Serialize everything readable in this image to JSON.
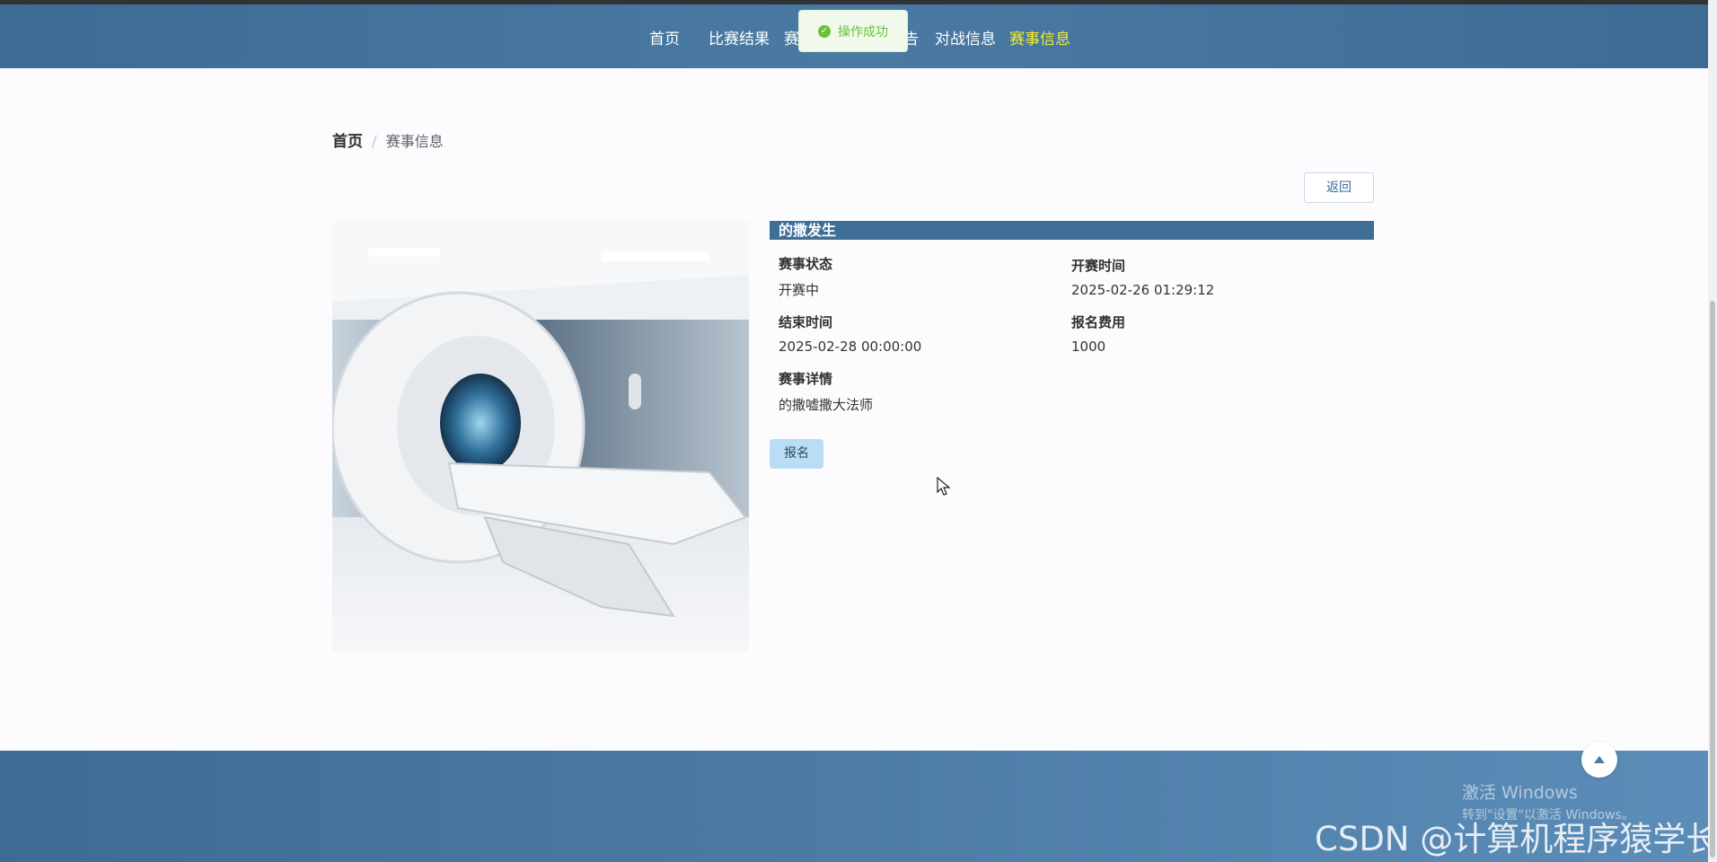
{
  "nav": {
    "items": [
      {
        "label": "首页"
      },
      {
        "label": "比赛结果"
      },
      {
        "label": "赛"
      },
      {
        "label": "告"
      },
      {
        "label": "对战信息"
      },
      {
        "label": "赛事信息",
        "active": true
      }
    ]
  },
  "toast": {
    "message": "操作成功",
    "icon": "check-circle-icon",
    "color": "#67c23a"
  },
  "breadcrumb": {
    "home": "首页",
    "separator": "/",
    "current": "赛事信息"
  },
  "back_label": "返回",
  "event": {
    "title": "的撒发生",
    "image_desc": "mri-scanner-photo",
    "fields": {
      "status": {
        "label": "赛事状态",
        "value": "开赛中"
      },
      "start_time": {
        "label": "开赛时间",
        "value": "2025-02-26 01:29:12"
      },
      "end_time": {
        "label": "结束时间",
        "value": "2025-02-28 00:00:00"
      },
      "fee": {
        "label": "报名费用",
        "value": "1000"
      },
      "details": {
        "label": "赛事详情",
        "value": "的撒嘘撒大法师"
      }
    },
    "signup_label": "报名"
  },
  "os_overlay": {
    "line1": "激活 Windows",
    "line2": "转到\"设置\"以激活 Windows。"
  },
  "watermark": "CSDN @计算机程序猿学长",
  "colors": {
    "nav_bg": "#3d6b94",
    "nav_active": "#f2ee3a",
    "accent_button": "#b8ddf5"
  }
}
